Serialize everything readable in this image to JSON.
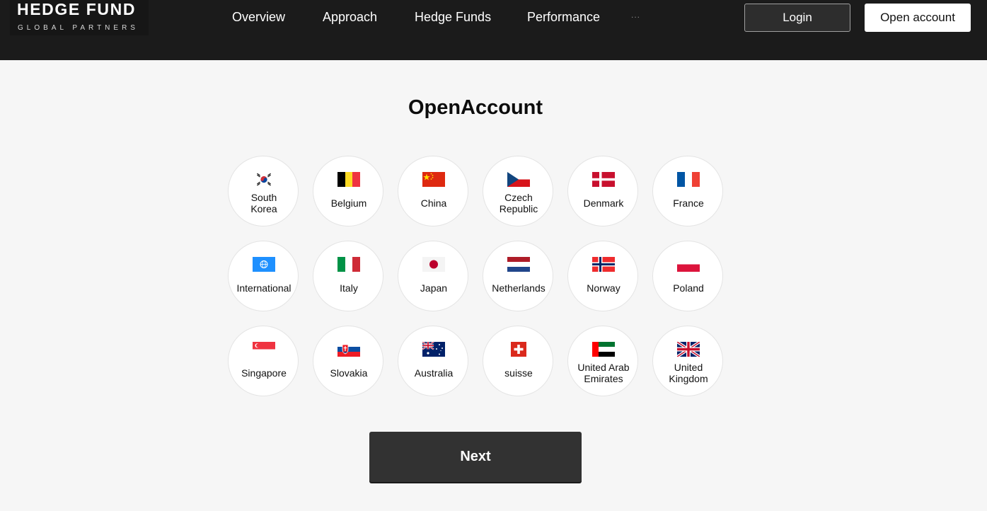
{
  "header": {
    "logo_main": "HEDGE FUND",
    "logo_sub": "GLOBAL PARTNERS",
    "nav": [
      "Overview",
      "Approach",
      "Hedge Funds",
      "Performance"
    ],
    "more": "...",
    "login_label": "Login",
    "open_account_label": "Open account"
  },
  "main": {
    "title": "OpenAccount",
    "countries": [
      {
        "name_lines": [
          "South",
          "Korea"
        ],
        "flag": "south-korea-flag"
      },
      {
        "name_lines": [
          "Belgium"
        ],
        "flag": "belgium-flag"
      },
      {
        "name_lines": [
          "China"
        ],
        "flag": "china-flag"
      },
      {
        "name_lines": [
          "Czech",
          "Republic"
        ],
        "flag": "czech-republic-flag"
      },
      {
        "name_lines": [
          "Denmark"
        ],
        "flag": "denmark-flag"
      },
      {
        "name_lines": [
          "France"
        ],
        "flag": "france-flag"
      },
      {
        "name_lines": [
          "International"
        ],
        "flag": "international-flag"
      },
      {
        "name_lines": [
          "Italy"
        ],
        "flag": "italy-flag"
      },
      {
        "name_lines": [
          "Japan"
        ],
        "flag": "japan-flag"
      },
      {
        "name_lines": [
          "Netherlands"
        ],
        "flag": "netherlands-flag"
      },
      {
        "name_lines": [
          "Norway"
        ],
        "flag": "norway-flag"
      },
      {
        "name_lines": [
          "Poland"
        ],
        "flag": "poland-flag"
      },
      {
        "name_lines": [
          "Singapore"
        ],
        "flag": "singapore-flag"
      },
      {
        "name_lines": [
          "Slovakia"
        ],
        "flag": "slovakia-flag"
      },
      {
        "name_lines": [
          "Australia"
        ],
        "flag": "australia-flag"
      },
      {
        "name_lines": [
          "suisse"
        ],
        "flag": "switzerland-flag"
      },
      {
        "name_lines": [
          "United Arab",
          "Emirates"
        ],
        "flag": "uae-flag"
      },
      {
        "name_lines": [
          "United",
          "Kingdom"
        ],
        "flag": "united-kingdom-flag"
      }
    ],
    "next_label": "Next"
  },
  "colors": {
    "header_bg": "#1b1b1b",
    "page_bg": "#f6f6f6",
    "button_dark": "#323232",
    "button_light": "#ffffff"
  }
}
